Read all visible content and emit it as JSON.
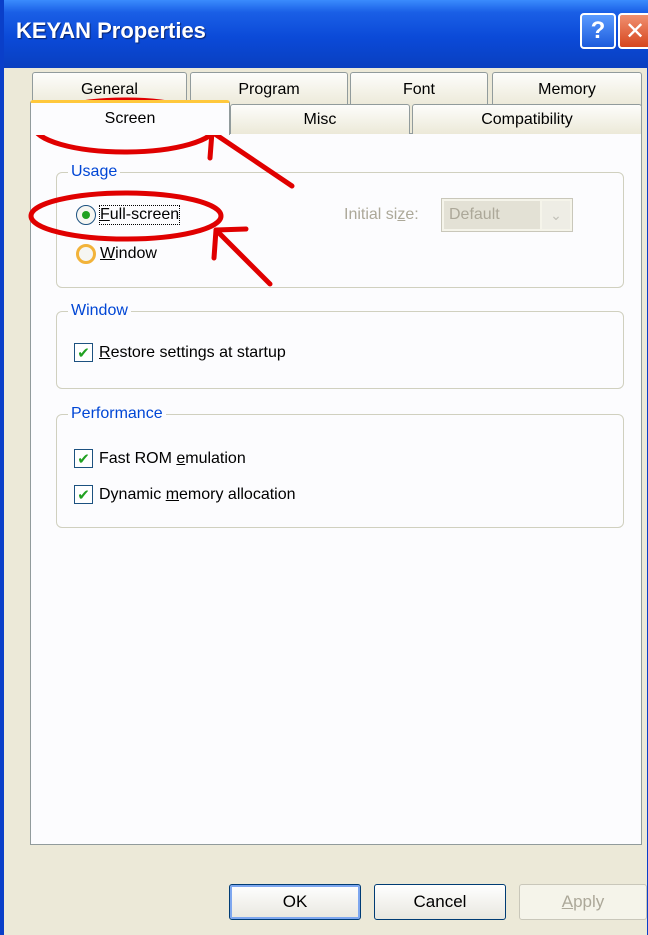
{
  "window": {
    "title": "KEYAN Properties",
    "help_label": "?",
    "close_label": "✕"
  },
  "tabs": {
    "row1": [
      "General",
      "Program",
      "Font",
      "Memory"
    ],
    "row2": [
      "Screen",
      "Misc",
      "Compatibility"
    ],
    "active": "Screen"
  },
  "usage": {
    "label": "Usage",
    "fullscreen": {
      "prefix": "",
      "accel": "F",
      "rest": "ull-screen",
      "selected": true
    },
    "window": {
      "accel": "W",
      "rest": "indow",
      "selected": false
    },
    "initial_size_label_pre": "Initial si",
    "initial_size_label_accel": "z",
    "initial_size_label_post": "e:",
    "initial_size_value": "Default"
  },
  "window_group": {
    "label": "Window",
    "restore": {
      "accel": "R",
      "rest": "estore settings at startup",
      "checked": true
    }
  },
  "performance": {
    "label": "Performance",
    "fast_rom": {
      "pre": "Fast ROM ",
      "accel": "e",
      "post": "mulation",
      "checked": true
    },
    "dynamic_mem": {
      "pre": "Dynamic ",
      "accel": "m",
      "post": "emory allocation",
      "checked": true
    }
  },
  "buttons": {
    "ok": "OK",
    "cancel": "Cancel",
    "apply_accel": "A",
    "apply_rest": "pply"
  },
  "icons": {
    "check": "✔",
    "combo_arrow": "⌄"
  },
  "colors": {
    "titlebar": "#0b4ad8",
    "group_label": "#0046d5",
    "annotation": "#e00000",
    "active_tab_highlight": "#ffc83c"
  }
}
